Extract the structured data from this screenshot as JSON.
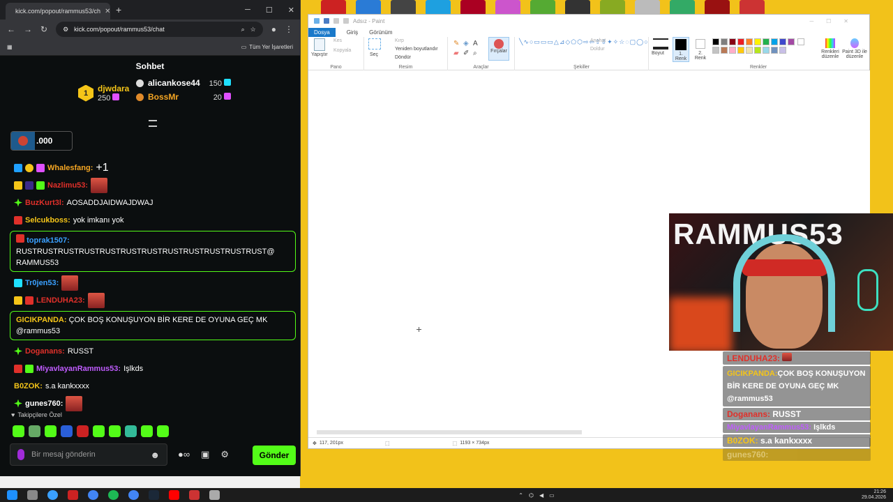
{
  "browser": {
    "tab_title": "kick.com/popout/rammus53/ch",
    "url": "kick.com/popout/rammus53/chat",
    "bookmarks_label": "Tüm Yer İşaretleri"
  },
  "chat": {
    "title": "Sohbet",
    "leaderboard": [
      {
        "rank": "1",
        "name": "djwdara",
        "value": "250"
      },
      {
        "rank": "2",
        "name": "alicankose44",
        "value": "150"
      },
      {
        "rank": "3",
        "name": "BossMr",
        "value": "20"
      }
    ],
    "pinned_value": ".000",
    "messages": [
      {
        "user": "Whalesfang:",
        "text": "+1",
        "color": "#f5a623",
        "highlight": false
      },
      {
        "user": "Nazlimu53:",
        "text": "",
        "color": "#e0302a",
        "highlight": false
      },
      {
        "user": "BuzKurt3l:",
        "text": "AOSADDJAIDWAJDWAJ",
        "color": "#e0302a",
        "highlight": false
      },
      {
        "user": "Selcukboss:",
        "text": "yok imkanı yok",
        "color": "#f5c518",
        "highlight": false
      },
      {
        "user": "toprak1507:",
        "text": "RUSTRUSTRUSTRUSTRUSTRUSTRUSTRUSTRUSTRUSTRUSTRUST@ RAMMUS53",
        "color": "#3aa0ff",
        "highlight": true
      },
      {
        "user": "Tr0jen53:",
        "text": "",
        "color": "#3aa0ff",
        "highlight": false
      },
      {
        "user": "LENDUHA23:",
        "text": "",
        "color": "#e0302a",
        "highlight": false
      },
      {
        "user": "GICIKPANDA:",
        "text": "ÇOK BOŞ KONUŞUYON BİR KERE DE OYUNA GEÇ MK @rammus53",
        "color": "#f5c518",
        "highlight": true
      },
      {
        "user": "Doganans:",
        "text": "RUSST",
        "color": "#e0302a",
        "highlight": false
      },
      {
        "user": "MiyavlayanRammus53:",
        "text": "Işlkds",
        "color": "#c05cff",
        "highlight": false
      },
      {
        "user": "B0ZOK:",
        "text": "s.a kankxxxx",
        "color": "#f5c518",
        "highlight": false
      },
      {
        "user": "gunes760:",
        "text": "",
        "color": "#fff",
        "highlight": false
      }
    ],
    "followers_only": "Takipçilere Özel",
    "input_placeholder": "Bir mesaj gönderin",
    "send_label": "Gönder"
  },
  "paint": {
    "title": "Adsız - Paint",
    "tabs": [
      "Dosya",
      "Giriş",
      "Görünüm"
    ],
    "groups": {
      "pano": "Pano",
      "resim": "Resim",
      "araclar": "Araçlar",
      "sekiller": "Şekiller",
      "renkler": "Renkler"
    },
    "buttons": {
      "yapistir": "Yapıştır",
      "kes": "Kes",
      "kopyala": "Kopyala",
      "sec": "Seç",
      "kirp": "Kırp",
      "yeniden": "Yeniden boyutlandır",
      "dondur": "Döndür",
      "fircalar": "Fırçalar",
      "anahat": "Anahat",
      "doldur": "Doldur",
      "boyut": "Boyut",
      "renk1": "1. Renk",
      "renk2": "2. Renk",
      "renkleri_duzenle": "Renkleri düzenle",
      "paint3d": "Paint 3D ile düzenle"
    },
    "status_pos": "117, 201px",
    "status_size": "1193 × 734px"
  },
  "overlay": [
    {
      "user": "LENDUHA23:",
      "text": "",
      "color": "#e0302a"
    },
    {
      "user": "GICIKPANDA:",
      "text": "ÇOK BOŞ KONUŞUYON BİR KERE DE OYUNA GEÇ MK @rammus53",
      "color": "#f5c518"
    },
    {
      "user": "Doganans:",
      "text": "RUSST",
      "color": "#e0302a"
    },
    {
      "user": "MiyavlayanRammus53:",
      "text": "Işlkds",
      "color": "#c05cff"
    },
    {
      "user": "B0ZOK:",
      "text": "s.a kankxxxx",
      "color": "#f5c518"
    },
    {
      "user": "gunes760:",
      "text": "",
      "color": "#ccc"
    }
  ],
  "taskbar": {
    "time": "21:26",
    "date": "29.04.2026"
  },
  "colors": {
    "kick_green": "#53fc18",
    "paint_accent": "#1979ca"
  }
}
